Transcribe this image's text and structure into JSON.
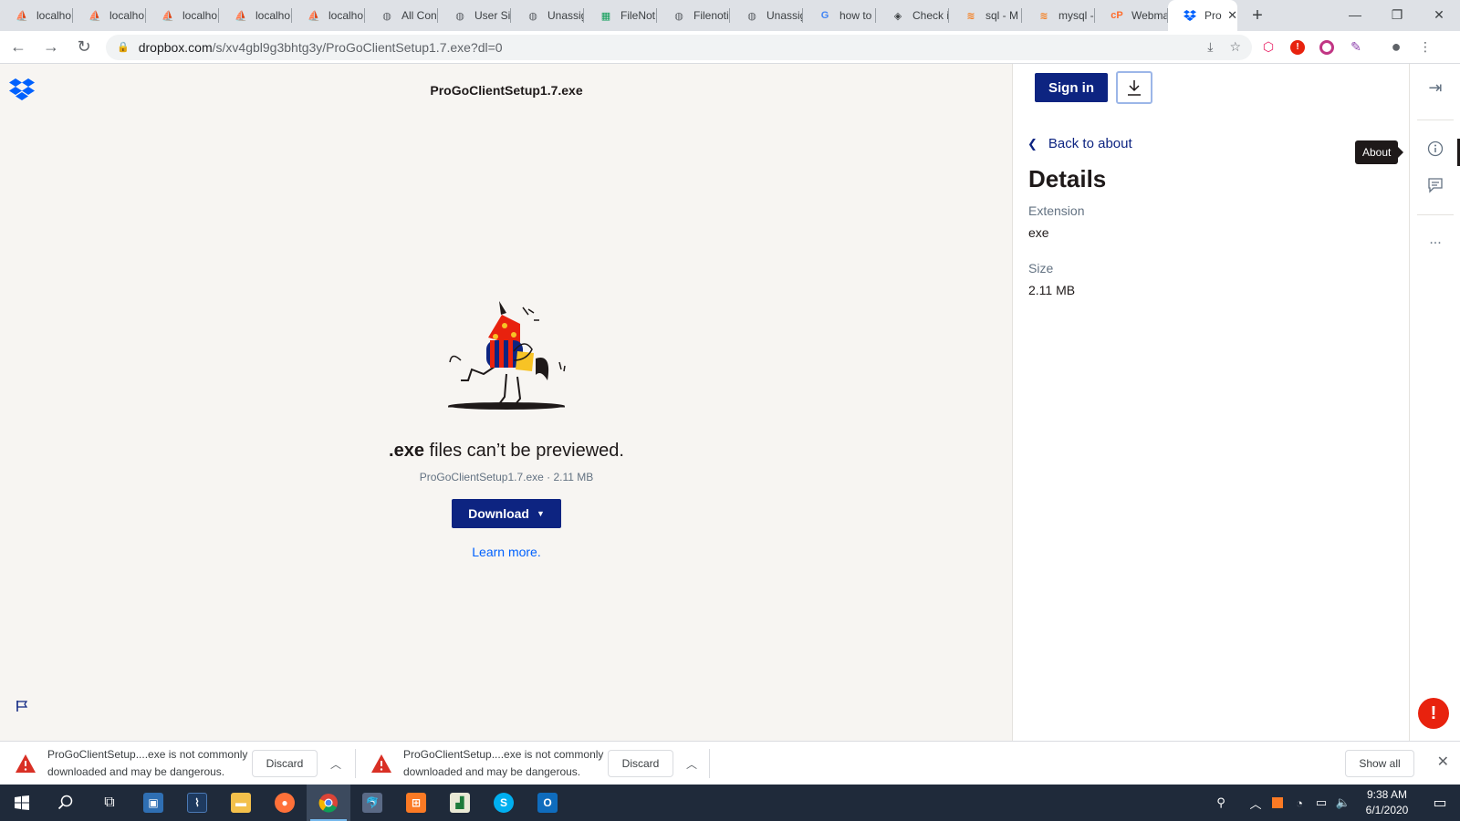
{
  "browser": {
    "tabs": [
      {
        "label": "localho",
        "icon": "phpmyadmin-icon",
        "color": "#f29111"
      },
      {
        "label": "localho",
        "icon": "phpmyadmin-icon",
        "color": "#f29111"
      },
      {
        "label": "localho",
        "icon": "phpmyadmin-icon",
        "color": "#f29111"
      },
      {
        "label": "localho",
        "icon": "phpmyadmin-icon",
        "color": "#f29111"
      },
      {
        "label": "localho",
        "icon": "phpmyadmin-icon",
        "color": "#f29111"
      },
      {
        "label": "All Con",
        "icon": "globe-icon",
        "color": "#5f6368"
      },
      {
        "label": "User Sig",
        "icon": "globe-icon",
        "color": "#5f6368"
      },
      {
        "label": "Unassig",
        "icon": "globe-icon",
        "color": "#5f6368"
      },
      {
        "label": "FileNot",
        "icon": "sheets-icon",
        "color": "#0f9d58"
      },
      {
        "label": "Filenoti",
        "icon": "globe-icon",
        "color": "#5f6368"
      },
      {
        "label": "Unassig",
        "icon": "globe-icon",
        "color": "#5f6368"
      },
      {
        "label": "how to",
        "icon": "google-icon",
        "color": "#4285f4"
      },
      {
        "label": "Check i",
        "icon": "diamond-icon",
        "color": "#3c4043"
      },
      {
        "label": "sql - M",
        "icon": "stackoverflow-icon",
        "color": "#f48024"
      },
      {
        "label": "mysql -",
        "icon": "stackoverflow-icon",
        "color": "#f48024"
      },
      {
        "label": "Webma",
        "icon": "cpanel-icon",
        "color": "#ff6c2c"
      }
    ],
    "active_tab": {
      "label": "Pro",
      "icon": "dropbox-icon"
    },
    "url_host": "dropbox.com",
    "url_path": "/s/xv4gbl9g3bhtg3y/ProGoClientSetup1.7.exe?dl=0"
  },
  "preview": {
    "file_title": "ProGoClientSetup1.7.exe",
    "message_ext": ".exe",
    "message_rest": " files can’t be previewed.",
    "file_info": "ProGoClientSetup1.7.exe · 2.11 MB",
    "download_label": "Download",
    "learn_more": "Learn more."
  },
  "details": {
    "signin_label": "Sign in",
    "back_label": "Back to about",
    "heading": "Details",
    "extension_label": "Extension",
    "extension_value": "exe",
    "size_label": "Size",
    "size_value": "2.11 MB"
  },
  "rail": {
    "tooltip": "About",
    "more": "..."
  },
  "downloads": {
    "items": [
      {
        "text": "ProGoClientSetup....exe is not commonly downloaded and may be dangerous.",
        "discard": "Discard"
      },
      {
        "text": "ProGoClientSetup....exe is not commonly downloaded and may be dangerous.",
        "discard": "Discard"
      }
    ],
    "show_all": "Show all"
  },
  "taskbar": {
    "time": "9:38 AM",
    "date": "6/1/2020"
  },
  "colors": {
    "dropbox_blue": "#0d2481",
    "link_blue": "#0061fe",
    "warning_red": "#e8220e"
  }
}
